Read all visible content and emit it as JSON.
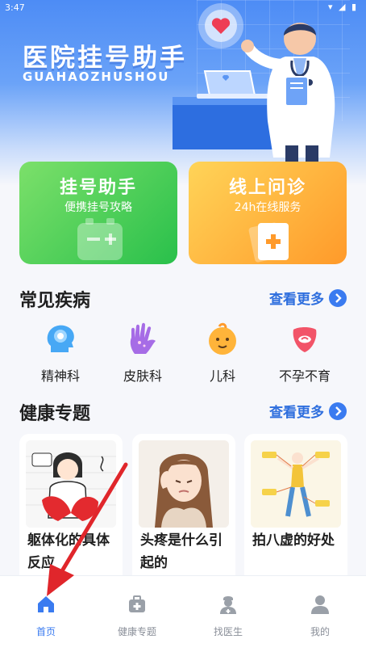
{
  "status": {
    "time": "3:47"
  },
  "hero": {
    "title": "医院挂号助手",
    "subtitle": "GUAHAOZHUSHOU"
  },
  "cards": [
    {
      "title": "挂号助手",
      "subtitle": "便携挂号攻略",
      "icon": "battery-card-icon"
    },
    {
      "title": "线上问诊",
      "subtitle": "24h在线服务",
      "icon": "book-plus-icon"
    }
  ],
  "diseases": {
    "title": "常见疾病",
    "more": "查看更多",
    "items": [
      {
        "label": "精神科",
        "icon": "head-icon"
      },
      {
        "label": "皮肤科",
        "icon": "hand-icon"
      },
      {
        "label": "儿科",
        "icon": "baby-icon"
      },
      {
        "label": "不孕不育",
        "icon": "uterus-icon"
      }
    ]
  },
  "topics": {
    "title": "健康专题",
    "more": "查看更多",
    "items": [
      {
        "text": "躯体化的具体反应"
      },
      {
        "text": "头疼是什么引起的"
      },
      {
        "text": "拍八虚的好处"
      }
    ]
  },
  "nav": {
    "items": [
      {
        "label": "首页",
        "icon": "home-icon",
        "active": true
      },
      {
        "label": "健康专题",
        "icon": "medkit-icon",
        "active": false
      },
      {
        "label": "找医生",
        "icon": "doctor-icon",
        "active": false
      },
      {
        "label": "我的",
        "icon": "user-icon",
        "active": false
      }
    ]
  },
  "colors": {
    "primary": "#3a7bf0",
    "green": "#29c04b",
    "orange": "#ff9a2a",
    "annotation": "#e0262b"
  }
}
